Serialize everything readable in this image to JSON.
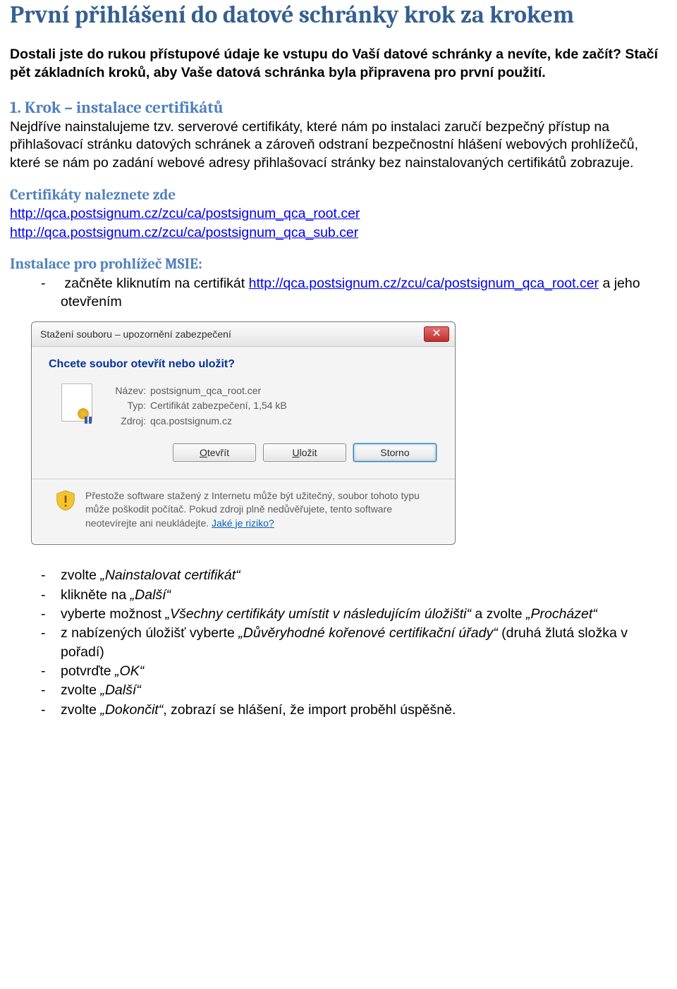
{
  "title": "První přihlášení do datové schránky krok za krokem",
  "intro": "Dostali jste do rukou přístupové údaje ke vstupu do Vaší datové schránky a nevíte, kde začít? Stačí pět základních kroků, aby Vaše datová schránka byla připravena pro první použití.",
  "step1_heading": "1. Krok – instalace certifikátů",
  "step1_body": "Nejdříve nainstalujeme tzv. serverové certifikáty, které nám po instalaci zaručí bezpečný přístup na přihlašovací stránku datových schránek a zároveň odstraní bezpečnostní hlášení webových prohlížečů, které se nám po zadání webové adresy přihlašovací stránky bez nainstalovaných certifikátů zobrazuje.",
  "cert_heading": "Certifikáty naleznete zde",
  "link1": "http://qca.postsignum.cz/zcu/ca/postsignum_qca_root.cer",
  "link2": "http://qca.postsignum.cz/zcu/ca/postsignum_qca_sub.cer",
  "msie_heading": "Instalace pro prohlížeč MSIE:",
  "msie_intro_text": "začněte kliknutím na certifikát ",
  "msie_intro_link": "http://qca.postsignum.cz/zcu/ca/postsignum_qca_root.cer",
  "msie_intro_trail": " a jeho otevřením",
  "dialog": {
    "title": "Stažení souboru – upozornění zabezpečení",
    "heading": "Chcete soubor otevřít nebo uložit?",
    "name_label": "Název:",
    "name_value": "postsignum_qca_root.cer",
    "type_label": "Typ:",
    "type_value": "Certifikát zabezpečení, 1,54 kB",
    "source_label": "Zdroj:",
    "source_value": "qca.postsignum.cz",
    "btn_open": "Otevřít",
    "btn_save": "Uložit",
    "btn_cancel": "Storno",
    "warn_text": "Přestože software stažený z Internetu může být užitečný, soubor tohoto typu může poškodit počítač. Pokud zdroji plně nedůvěřujete, tento software neotevírejte ani neukládejte. ",
    "risk_link": "Jaké je riziko?"
  },
  "steps": [
    {
      "pre": "zvolte ",
      "em": "„Nainstalovat certifikát“",
      "post": ""
    },
    {
      "pre": "klikněte na ",
      "em": "„Další“",
      "post": ""
    },
    {
      "pre": "vyberte možnost ",
      "em": "„Všechny certifikáty umístit v následujícím úložišti“",
      "post": " a zvolte ",
      "em2": "„Procházet“"
    },
    {
      "pre": "z nabízených úložišť vyberte ",
      "em": "„Důvěryhodné kořenové certifikační úřady“",
      "post": " (druhá žlutá složka v pořadí)"
    },
    {
      "pre": "potvrďte ",
      "em": "„OK“",
      "post": ""
    },
    {
      "pre": "zvolte ",
      "em": "„Další“",
      "post": ""
    },
    {
      "pre": "zvolte ",
      "em": "„Dokončit“",
      "post": ", zobrazí se hlášení, že import proběhl úspěšně."
    }
  ]
}
